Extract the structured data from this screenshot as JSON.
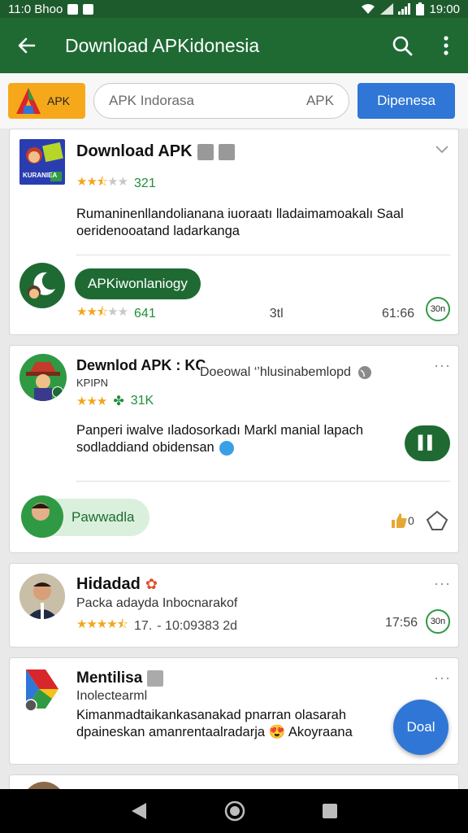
{
  "status_bar": {
    "time_left": "11:0 Bhoo",
    "time_right": "19:00"
  },
  "app_bar": {
    "title": "Download APKidonesia",
    "back_icon": "arrow-left-icon",
    "search_icon": "search-icon",
    "menu_icon": "more-vert-icon"
  },
  "search": {
    "logo_text": "APK",
    "placeholder": "APK Indorasa",
    "suffix": "APK",
    "button_label": "Dipenesa"
  },
  "cards": [
    {
      "title": "Download APK",
      "app_icon_text": "KURANIEA",
      "rating_stars": 2.5,
      "rating_value": "321",
      "desc_line1": "Rumaninenllandolianana iuoraatı lladaimamoakalı Saal",
      "desc_line2": "oeridenooatand ladarkanga",
      "pill_label": "APKiwonlaniogy",
      "footer_stars": 2.5,
      "footer_value": "641",
      "footer_mid": "3tl",
      "footer_time": "61:66",
      "footer_badge": "30n"
    },
    {
      "title": "Dewnlod APK : KC",
      "sub": "KPIPN",
      "overlay_text": "Doeowal ‘’hlusinabemlopd",
      "rating_stars": 3,
      "rating_value": "31K",
      "desc_line1": "Panperi iwalve ıladosorkadı Markl manial lapach",
      "desc_line2": "sodladdiand obidensan",
      "action_label": "▌▌",
      "pill_label": "Pawwadla",
      "like_count": "0"
    },
    {
      "title": "Hidadad",
      "sub": "Packa adayda Inbocnarakof",
      "rating_stars": 4.5,
      "rating_value": "17.",
      "rating_extra": "- 10:09383  2d",
      "time": "17:56",
      "badge": "30n"
    },
    {
      "title": "Mentilisa",
      "sub": "Inolectearml",
      "desc_line1": "Kimanmadtaikankasanakad pnarran olasarah",
      "desc_line2": "dpaineskan amanrentaalradarja 😍 Akoyraana"
    }
  ],
  "fab": {
    "label": "Doal"
  },
  "colors": {
    "primary": "#1f6a33",
    "accent_blue": "#2f76d6",
    "star": "#f2a61b",
    "logo_orange": "#f5a91a"
  },
  "nav": {
    "back_icon": "triangle-back-icon",
    "home_icon": "circle-home-icon",
    "recents_icon": "square-recents-icon"
  }
}
